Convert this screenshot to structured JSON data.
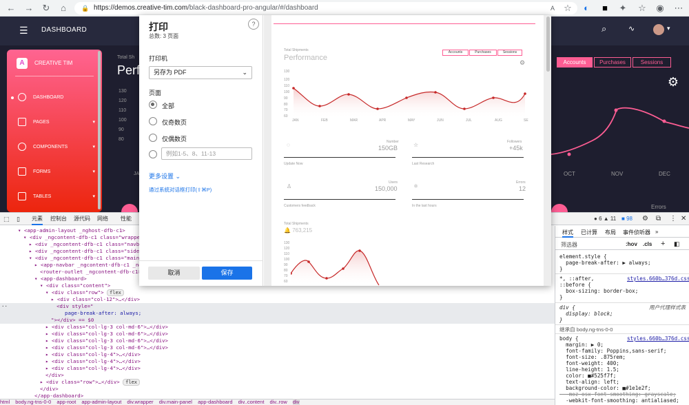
{
  "browser": {
    "url_host": "https://demos.creative-tim.com",
    "url_path": "/black-dashboard-pro-angular/#/dashboard"
  },
  "dashboard": {
    "header_title": "DASHBOARD",
    "brand": "CREATIVE TIM",
    "sidebar_items": [
      {
        "label": "DASHBOARD",
        "caret": ""
      },
      {
        "label": "PAGES",
        "caret": "▾"
      },
      {
        "label": "COMPONENTS",
        "caret": "▾"
      },
      {
        "label": "FORMS",
        "caret": "▾"
      },
      {
        "label": "TABLES",
        "caret": "▾"
      }
    ],
    "chart_subtitle": "Total Sh",
    "chart_title": "Perf",
    "ticks": [
      "130",
      "120",
      "110",
      "100",
      "90",
      "80"
    ],
    "tabs": [
      "Accounts",
      "Purchases",
      "Sessions"
    ],
    "month_labels": [
      "OCT",
      "NOV",
      "DEC"
    ],
    "first_month_fragment": "JA",
    "errors_label": "Errors"
  },
  "print_dialog": {
    "title": "打印",
    "total": "总数: 3 页面",
    "help": "?",
    "printer_label": "打印机",
    "printer_value": "另存为 PDF",
    "pages_label": "页面",
    "options": [
      "全部",
      "仅奇数页",
      "仅偶数页"
    ],
    "range_placeholder": "例如1-5、8、11-13",
    "more_settings": "更多设置",
    "system_dialog": "通过系统对话框打印(⇧⌘P)",
    "cancel": "取消",
    "save": "保存"
  },
  "preview": {
    "shipments_label": "Total Shipments",
    "performance": "Performance",
    "tabs": [
      "Accounts",
      "Purchases",
      "Sessions"
    ],
    "yticks": [
      "130",
      "120",
      "110",
      "100",
      "90",
      "80",
      "70",
      "60"
    ],
    "months": [
      "JAN",
      "FEB",
      "MAR",
      "APR",
      "MAY",
      "JUN",
      "JUL",
      "AUG",
      "SE"
    ],
    "stats": [
      {
        "name": "Number",
        "value": "150GB",
        "foot": "Update Now"
      },
      {
        "name": "Followers",
        "value": "+45k",
        "foot": "Last Research"
      },
      {
        "name": "Users",
        "value": "150,000",
        "foot": "Customers feedback"
      },
      {
        "name": "Errors",
        "value": "12",
        "foot": "In the last hours"
      }
    ],
    "shipments_value": "763,215",
    "small_yticks": [
      "130",
      "120",
      "110",
      "100",
      "90",
      "80",
      "70",
      "60"
    ]
  },
  "devtools": {
    "tabs": [
      "元素",
      "控制台",
      "源代码",
      "网络",
      "性能"
    ],
    "counts": [
      "6",
      "11",
      "98"
    ],
    "dom_lines": [
      "<app-admin-layout _nghost-dfb-c1>",
      "<div _ngcontent-dfb-c1 class=\"wrapper\">",
      "<div _ngcontent-dfb-c1 class=\"navba",
      "<div _ngcontent-dfb-c1 class=\"sideba",
      "<div _ngcontent-dfb-c1 class=\"main-p",
      "<app-navbar _ngcontent-dfb-c1 _ngh",
      "<router-outlet _ngcontent-dfb-c1></",
      "<app-dashboard>",
      "<div class=\"content\">",
      "<div class=\"row\">",
      "<div class=\"col-12\">…</div>",
      "<div style=\"",
      "page-break-after: always;",
      "\"></div> == $0",
      "<div class=\"col-lg-3 col-md-6\">…</div>",
      "<div class=\"col-lg-3 col-md-6\">…</div>",
      "<div class=\"col-lg-3 col-md-6\">…</div>",
      "<div class=\"col-lg-3 col-md-6\">…</div>",
      "<div class=\"col-lg-4\">…</div>",
      "<div class=\"col-lg-4\">…</div>",
      "<div class=\"col-lg-4\">…</div>",
      "</div>",
      "<div class=\"row\">…</div>",
      "</div>",
      "</app-dashboard>"
    ],
    "flex_badge": "flex",
    "breadcrumbs": [
      "html",
      "body.ng-tns-0-0",
      "app-root",
      "app-admin-layout",
      "div.wrapper",
      "div.main-panel",
      "app-dashboard",
      "div..content",
      "div..row",
      "div"
    ],
    "styles_tabs": [
      "样式",
      "已计算",
      "布局",
      "事件侦听器"
    ],
    "filter_placeholder": "筛选器",
    "filter_hov": ":hov",
    "filter_cls": ".cls",
    "rules": [
      "element.style {",
      "  page-break-after: ▶ always;",
      "}",
      "*, ::after,",
      "::before {",
      "  box-sizing: border-box;",
      "}",
      "div {",
      "  display: block;",
      "}",
      "继承自 body.ng-tns-0-0",
      "body {",
      "  margin: ▶ 0;",
      "  font-family: Poppins,sans-serif;",
      "  font-size: .875rem;",
      "  font-weight: 400;",
      "  line-height: 1.5;",
      "  color: ■#525f7f;",
      "  text-align: left;",
      "  background-color: ■#1e1e2f;",
      "  -moz-osx-font-smoothing: grayscale;",
      "  -webkit-font-smoothing: antialiased;"
    ],
    "source_link": "styles.660b…376d.css:33",
    "ua_label": "用户代理样式表"
  },
  "colors": {
    "accent": "#fd5d93",
    "chart_line": "#c62828",
    "dark_bg": "#1e1e2f",
    "link": "#1a73e8"
  }
}
